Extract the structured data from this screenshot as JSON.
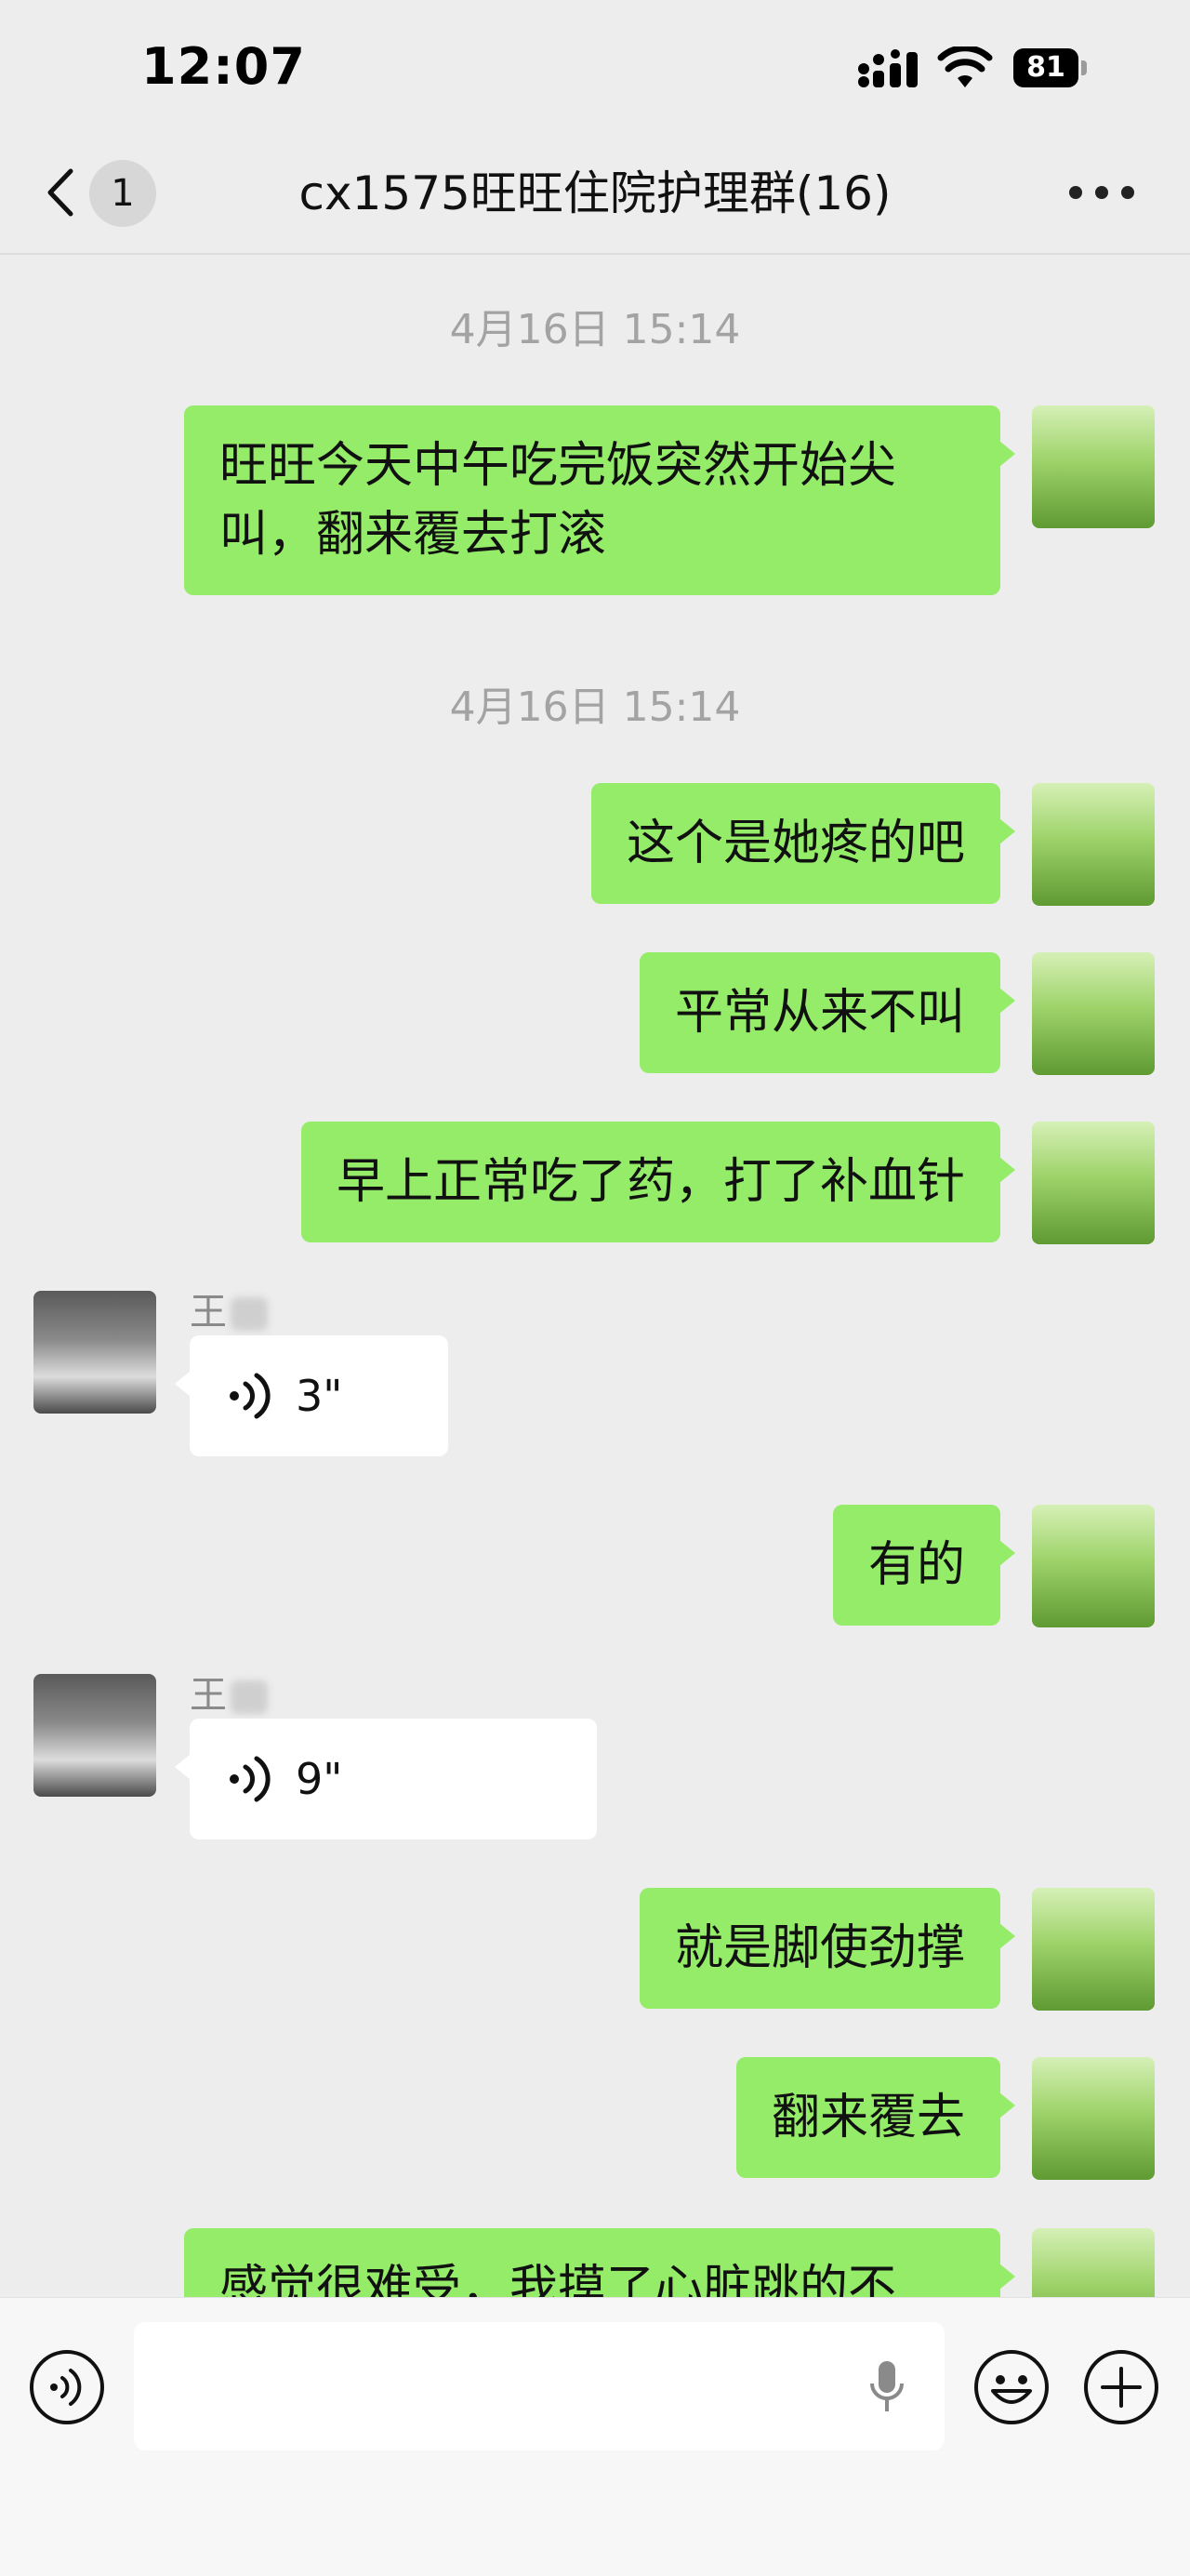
{
  "status_bar": {
    "time": "12:07",
    "battery": "81"
  },
  "nav": {
    "unread_count": "1",
    "title": "cx1575旺旺住院护理群(16)"
  },
  "messages": [
    {
      "type": "timestamp",
      "text": "4月16日 15:14"
    },
    {
      "type": "text",
      "from": "me",
      "lines": [
        "旺旺今天中午吃完饭突然开始尖",
        "叫，翻来覆去打滚"
      ]
    },
    {
      "type": "timestamp",
      "text": "4月16日 15:14"
    },
    {
      "type": "text",
      "from": "me",
      "lines": [
        "这个是她疼的吧"
      ]
    },
    {
      "type": "text",
      "from": "me",
      "lines": [
        "平常从来不叫"
      ]
    },
    {
      "type": "text",
      "from": "me",
      "lines": [
        "早上正常吃了药，打了补血针"
      ]
    },
    {
      "type": "voice",
      "from": "other",
      "sender": "王",
      "duration": "3\""
    },
    {
      "type": "text",
      "from": "me",
      "lines": [
        "有的"
      ]
    },
    {
      "type": "voice",
      "from": "other",
      "sender": "王",
      "duration": "9\""
    },
    {
      "type": "text",
      "from": "me",
      "lines": [
        "就是脚使劲撑"
      ]
    },
    {
      "type": "text",
      "from": "me",
      "lines": [
        "翻来覆去"
      ]
    },
    {
      "type": "text",
      "from": "me",
      "lines": [
        "感觉很难受，我摸了心脏跳的不"
      ]
    }
  ],
  "icons": {
    "back": "chevron-left-icon",
    "more": "more-dots-icon",
    "voice_toggle": "voice-toggle-icon",
    "mic": "mic-icon",
    "emoji": "emoji-icon",
    "plus": "plus-icon"
  },
  "colors": {
    "my_bubble": "#95ec69",
    "other_bubble": "#ffffff",
    "background": "#ededed"
  }
}
